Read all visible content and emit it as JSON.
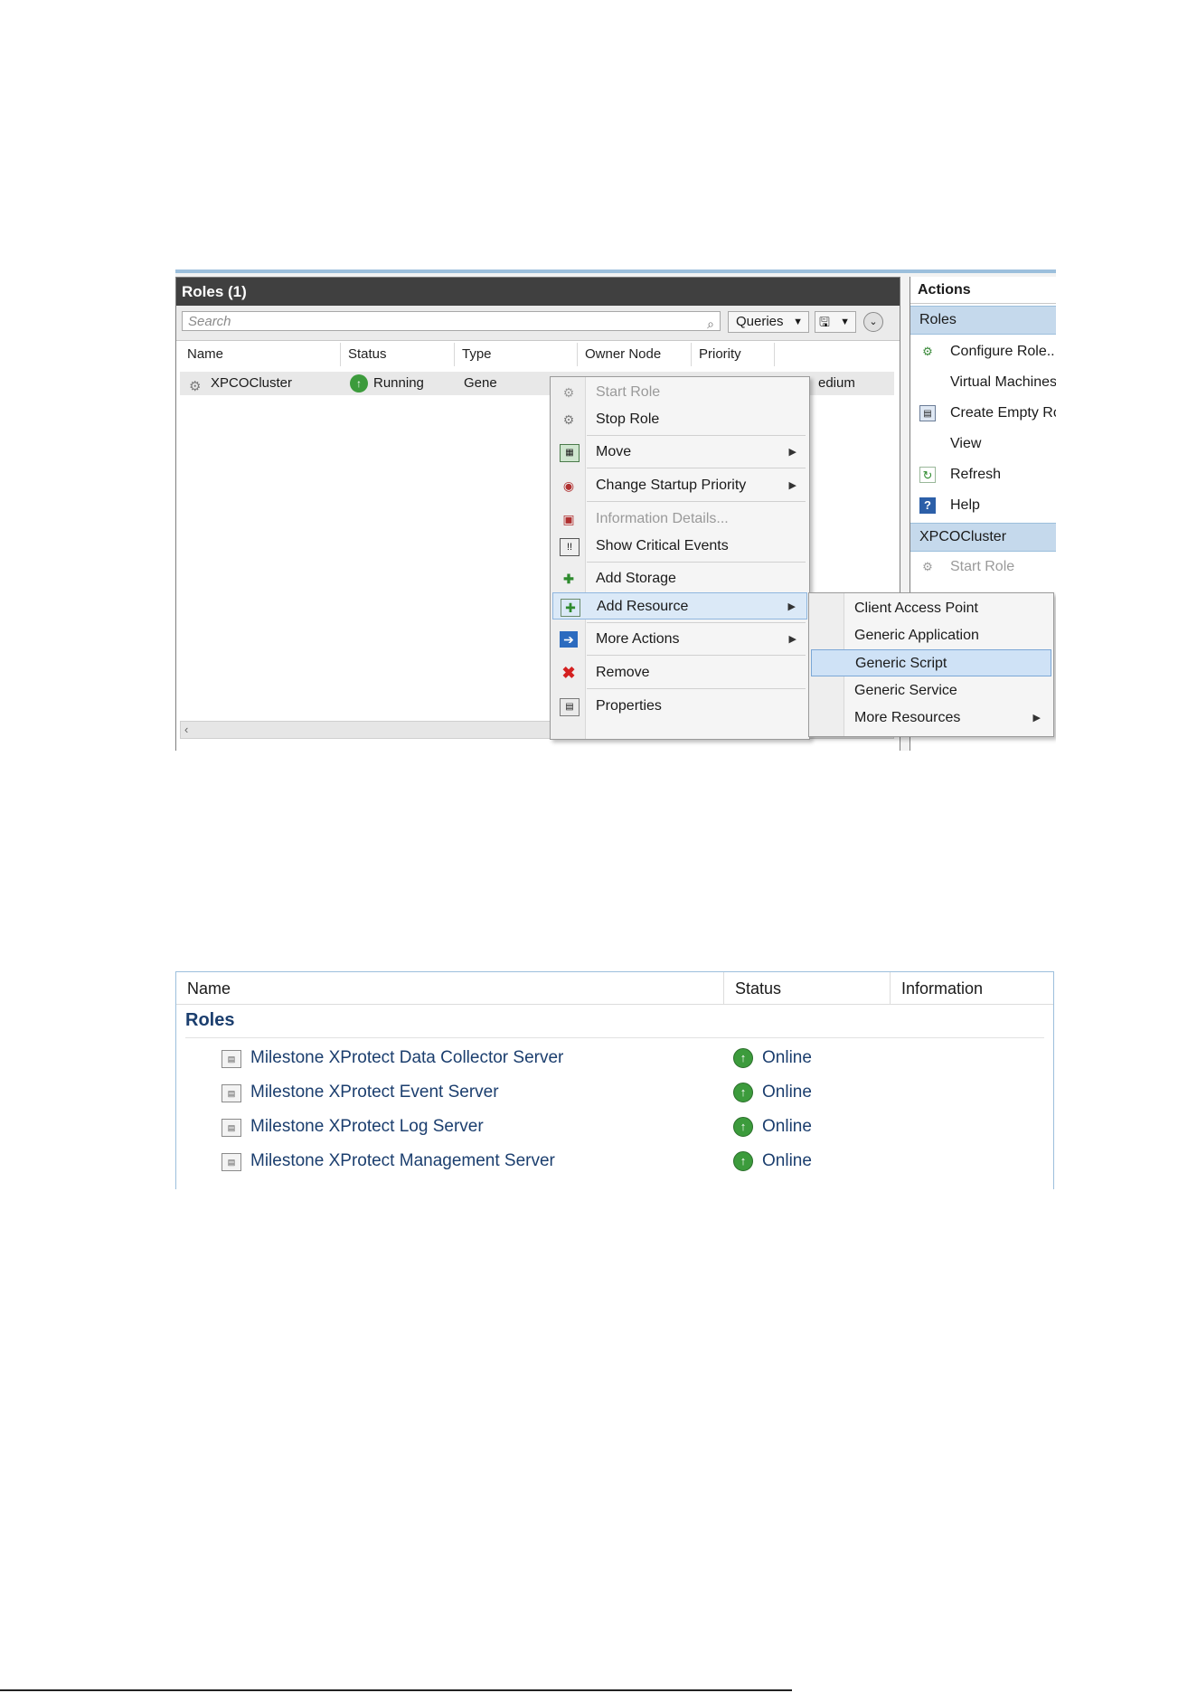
{
  "roles_window": {
    "title": "Roles (1)",
    "search_placeholder": "Search",
    "queries_label": "Queries",
    "columns": [
      "Name",
      "Status",
      "Type",
      "Owner Node",
      "Priority"
    ],
    "row": {
      "name": "XPCOCluster",
      "status": "Running",
      "type": "Gene",
      "priority": "edium"
    },
    "scroll_left": "‹"
  },
  "context_menu": {
    "items": [
      {
        "label": "Start Role",
        "disabled": true
      },
      {
        "label": "Stop Role"
      },
      {
        "label": "Move",
        "submenu": true
      },
      {
        "label": "Change Startup Priority",
        "submenu": true
      },
      {
        "label": "Information Details...",
        "disabled": true
      },
      {
        "label": "Show Critical Events"
      },
      {
        "label": "Add Storage"
      },
      {
        "label": "Add Resource",
        "submenu": true,
        "highlighted": true
      },
      {
        "label": "More Actions",
        "submenu": true
      },
      {
        "label": "Remove"
      },
      {
        "label": "Properties"
      }
    ]
  },
  "submenu": {
    "items": [
      {
        "label": "Client Access Point"
      },
      {
        "label": "Generic Application"
      },
      {
        "label": "Generic Script",
        "highlighted": true
      },
      {
        "label": "Generic Service"
      },
      {
        "label": "More Resources",
        "submenu": true
      }
    ]
  },
  "actions_pane": {
    "title": "Actions",
    "section_roles": "Roles",
    "items": [
      "Configure Role...",
      "Virtual Machines.",
      "Create Empty Rol",
      "View",
      "Refresh",
      "Help"
    ],
    "section_cluster": "XPCOCluster",
    "cluster_items": [
      "Start Role"
    ]
  },
  "roles_list": {
    "columns": [
      "Name",
      "Status",
      "Information"
    ],
    "group": "Roles",
    "rows": [
      {
        "name": "Milestone XProtect Data Collector Server",
        "status": "Online"
      },
      {
        "name": "Milestone XProtect Event Server",
        "status": "Online"
      },
      {
        "name": "Milestone XProtect Log Server",
        "status": "Online"
      },
      {
        "name": "Milestone XProtect Management Server",
        "status": "Online"
      }
    ]
  }
}
